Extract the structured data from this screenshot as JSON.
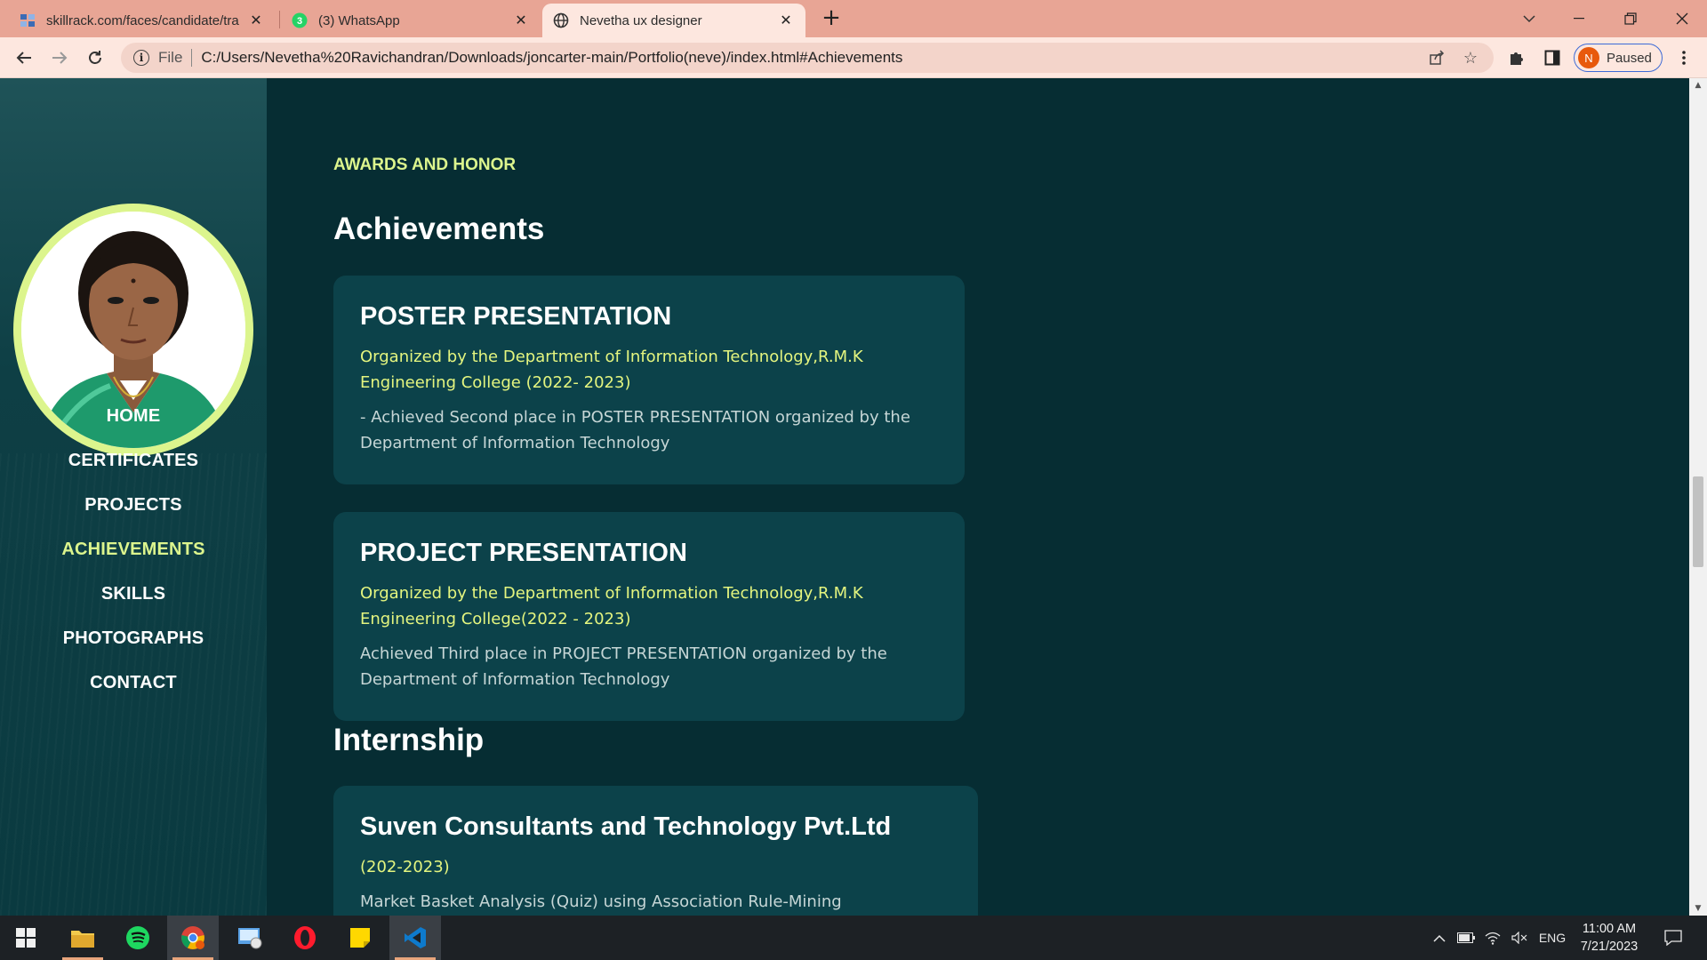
{
  "browser": {
    "tabs": [
      {
        "title": "skillrack.com/faces/candidate/tra",
        "favicon": "skillrack-icon"
      },
      {
        "title": "(3) WhatsApp",
        "favicon": "whatsapp-icon",
        "badge": "3"
      },
      {
        "title": "Nevetha ux designer",
        "favicon": "globe-icon"
      }
    ],
    "address": {
      "scheme": "File",
      "url": "C:/Users/Nevetha%20Ravichandran/Downloads/joncarter-main/Portfolio(neve)/index.html#Achievements"
    },
    "profile": {
      "initial": "N",
      "status": "Paused"
    }
  },
  "sidebar": {
    "nav": [
      "HOME",
      "CERTIFICATES",
      "PROJECTS",
      "ACHIEVEMENTS",
      "SKILLS",
      "PHOTOGRAPHS",
      "CONTACT"
    ],
    "active": "ACHIEVEMENTS"
  },
  "main": {
    "eyebrow": "AWARDS AND HONOR",
    "achievements_title": "Achievements",
    "achievements": [
      {
        "title": "POSTER PRESENTATION",
        "org": "Organized by the Department of Information Technology,R.M.K Engineering College (2022- 2023)",
        "desc": "- Achieved Second place in POSTER PRESENTATION organized by the Department of Information Technology"
      },
      {
        "title": "PROJECT PRESENTATION",
        "org": "Organized by the Department of Information Technology,R.M.K Engineering College(2022 - 2023)",
        "desc": "Achieved Third place in PROJECT PRESENTATION organized by the Department of Information Technology"
      }
    ],
    "internship_title": "Internship",
    "internships": [
      {
        "title": "Suven Consultants and Technology Pvt.Ltd",
        "org": "(202-2023)",
        "desc": "Market Basket Analysis (Quiz) using Association Rule-Mining"
      }
    ]
  },
  "taskbar": {
    "apps": [
      "start-icon",
      "file-explorer-icon",
      "spotify-icon",
      "chrome-icon",
      "control-panel-icon",
      "opera-icon",
      "sticky-notes-icon",
      "vscode-icon"
    ],
    "language": "ENG",
    "time": "11:00 AM",
    "date": "7/21/2023"
  },
  "colors": {
    "accent": "#dcf58d",
    "page_bg": "#062d33",
    "card_bg": "#0c424a",
    "tab_strip": "#e8a595"
  }
}
